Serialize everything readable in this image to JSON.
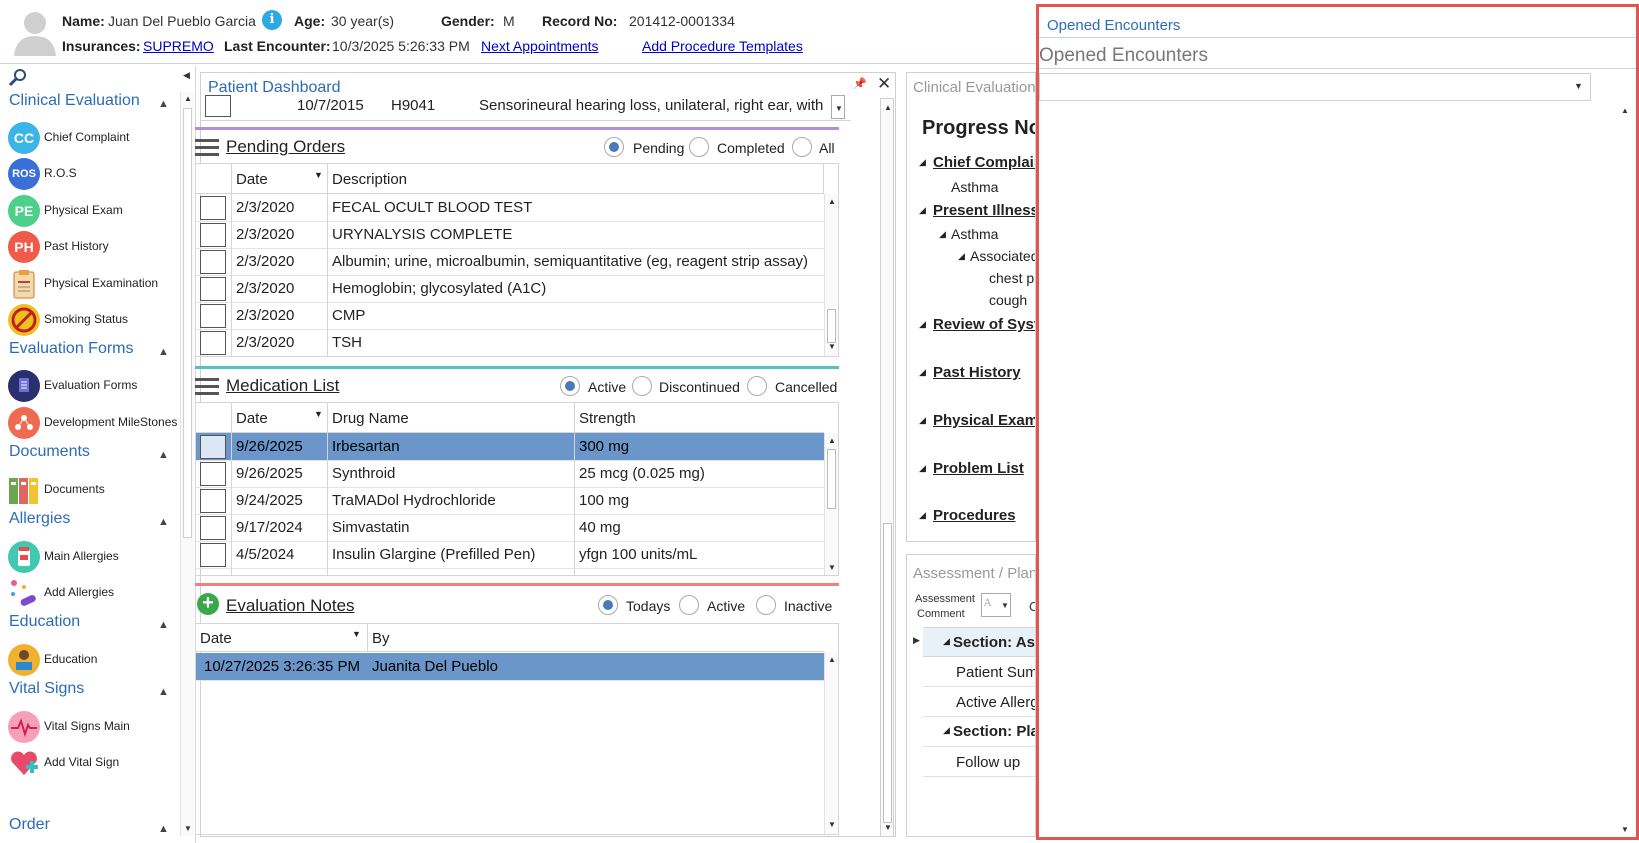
{
  "patient": {
    "name_label": "Name:",
    "name": "Juan Del Pueblo Garcia",
    "age_label": "Age:",
    "age": "30 year(s)",
    "gender_label": "Gender:",
    "gender": "M",
    "record_label": "Record No:",
    "record_no": "201412-0001334",
    "insurances_label": "Insurances:",
    "insurance": "SUPREMO",
    "last_encounter_label": "Last Encounter:",
    "last_encounter": "10/3/2025 5:26:33 PM",
    "next_appointments": "Next Appointments",
    "add_procedure_templates": "Add Procedure Templates"
  },
  "sidebar": {
    "sections": [
      {
        "title": "Clinical Evaluation",
        "items": [
          {
            "label": "Chief Complaint",
            "icon": "CC",
            "color": "#3bb4e8"
          },
          {
            "label": "R.O.S",
            "icon": "ROS",
            "color": "#3a6fd8"
          },
          {
            "label": "Physical Exam",
            "icon": "PE",
            "color": "#4cd08a"
          },
          {
            "label": "Past History",
            "icon": "PH",
            "color": "#ef5a4a"
          },
          {
            "label": "Physical Examination",
            "icon": "clipboard-icon",
            "color": "#e8a040"
          },
          {
            "label": "Smoking Status",
            "icon": "no-smoking-icon",
            "color": "#f0c020"
          }
        ]
      },
      {
        "title": "Evaluation Forms",
        "items": [
          {
            "label": "Evaluation Forms",
            "icon": "form-icon",
            "color": "#2a2f6e"
          },
          {
            "label": "Development MileStones",
            "icon": "milestones-icon",
            "color": "#ef6a50"
          }
        ]
      },
      {
        "title": "Documents",
        "items": [
          {
            "label": "Documents",
            "icon": "binders-icon",
            "color": "#6aa84f"
          }
        ]
      },
      {
        "title": "Allergies",
        "items": [
          {
            "label": "Main Allergies",
            "icon": "allergy-bottle-icon",
            "color": "#40c8b0"
          },
          {
            "label": "Add Allergies",
            "icon": "pills-icon",
            "color": "#8a6ad0"
          }
        ]
      },
      {
        "title": "Education",
        "items": [
          {
            "label": "Education",
            "icon": "reader-icon",
            "color": "#f0b030"
          }
        ]
      },
      {
        "title": "Vital Signs",
        "items": [
          {
            "label": "Vital Signs Main",
            "icon": "heartbeat-icon",
            "color": "#ef6a8a"
          },
          {
            "label": "Add Vital Sign",
            "icon": "heart-plus-icon",
            "color": "#e84a6a"
          }
        ]
      },
      {
        "title": "Order",
        "items": []
      }
    ]
  },
  "dashboard": {
    "title": "Patient Dashboard",
    "problem_row": {
      "date": "10/7/2015",
      "code": "H9041",
      "desc": "Sensorineural hearing loss, unilateral, right ear, with"
    },
    "pending": {
      "title": "Pending Orders",
      "filters": [
        "Pending",
        "Completed",
        "All"
      ],
      "col_date": "Date",
      "col_desc": "Description",
      "rows": [
        {
          "date": "2/3/2020",
          "desc": "FECAL OCULT BLOOD TEST"
        },
        {
          "date": "2/3/2020",
          "desc": "URYNALYSIS COMPLETE"
        },
        {
          "date": "2/3/2020",
          "desc": "Albumin; urine, microalbumin, semiquantitative (eg, reagent strip assay)"
        },
        {
          "date": "2/3/2020",
          "desc": "Hemoglobin; glycosylated (A1C)"
        },
        {
          "date": "2/3/2020",
          "desc": "CMP"
        },
        {
          "date": "2/3/2020",
          "desc": "TSH"
        }
      ]
    },
    "meds": {
      "title": "Medication List",
      "filters": [
        "Active",
        "Discontinued",
        "Cancelled"
      ],
      "col_date": "Date",
      "col_drug": "Drug Name",
      "col_strength": "Strength",
      "rows": [
        {
          "date": "9/26/2025",
          "drug": "Irbesartan",
          "strength": "300 mg"
        },
        {
          "date": "9/26/2025",
          "drug": "Synthroid",
          "strength": "25 mcg (0.025 mg)"
        },
        {
          "date": "9/24/2025",
          "drug": "TraMADol Hydrochloride",
          "strength": "100 mg"
        },
        {
          "date": "9/17/2024",
          "drug": "Simvastatin",
          "strength": "40 mg"
        },
        {
          "date": "4/5/2024",
          "drug": "Insulin Glargine (Prefilled Pen)",
          "strength": "yfgn 100 units/mL"
        }
      ]
    },
    "eval": {
      "title": "Evaluation Notes",
      "filters": [
        "Todays",
        "Active",
        "Inactive"
      ],
      "col_date": "Date",
      "col_by": "By",
      "rows": [
        {
          "date": "10/27/2025 3:26:35 PM",
          "by": "Juanita Del Pueblo"
        }
      ]
    }
  },
  "clinical": {
    "title": "Clinical Evaluation",
    "progress_notes": "Progress Not",
    "tree": [
      {
        "text": "Chief Complain",
        "bold": true
      },
      {
        "text": "Asthma",
        "bold": false
      },
      {
        "text": "Present Illness",
        "bold": true
      },
      {
        "text": "Asthma",
        "bold": false
      },
      {
        "text": "Associated",
        "bold": false
      },
      {
        "text": "chest p",
        "bold": false
      },
      {
        "text": "cough",
        "bold": false
      },
      {
        "text": "Review of Syst",
        "bold": true
      },
      {
        "text": "Past History",
        "bold": true
      },
      {
        "text": "Physical Exam",
        "bold": true
      },
      {
        "text": "Problem List",
        "bold": true
      },
      {
        "text": "Procedures",
        "bold": true
      }
    ]
  },
  "assessment": {
    "title": "Assessment / Plan",
    "comment_label_1": "Assessment",
    "comment_label_2": "Comment",
    "c_label": "C",
    "section_a": "Section: Ass",
    "patient_sum": "Patient Sum",
    "active_allerg": "Active Allerg",
    "section_p": "Section: Pla",
    "follow_up": "Follow up"
  },
  "encounters": {
    "header_link": "Opened Encounters",
    "title": "Opened Encounters"
  }
}
